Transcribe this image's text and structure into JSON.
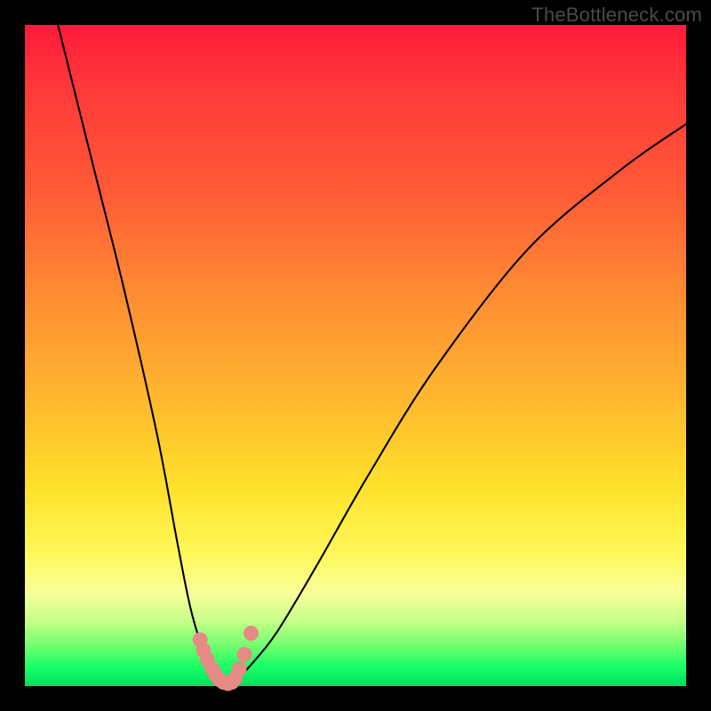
{
  "attribution": "TheBottleneck.com",
  "chart_data": {
    "type": "line",
    "title": "",
    "xlabel": "",
    "ylabel": "",
    "xlim": [
      0,
      100
    ],
    "ylim": [
      0,
      100
    ],
    "series": [
      {
        "name": "bottleneck-curve",
        "x": [
          5,
          10,
          15,
          20,
          23,
          25,
          27,
          28,
          29,
          30,
          31,
          32,
          34,
          38,
          44,
          52,
          62,
          76,
          90,
          100
        ],
        "values": [
          100,
          80,
          60,
          38,
          22,
          12,
          5,
          2,
          1,
          0,
          0,
          1,
          3,
          8,
          18,
          32,
          48,
          66,
          78,
          85
        ]
      }
    ],
    "markers": {
      "name": "highlight-points",
      "x": [
        26.5,
        27.0,
        27.6,
        28.3,
        28.8,
        29.4,
        30.0,
        30.7,
        31.3,
        31.8,
        32.4,
        33.2,
        34.2
      ],
      "values": [
        7.0,
        5.4,
        4.0,
        2.6,
        1.8,
        1.0,
        0.6,
        0.4,
        0.6,
        1.2,
        2.6,
        4.8,
        8.0
      ]
    },
    "gradient_stops": [
      {
        "pos": 0,
        "color": "#ff1a3a"
      },
      {
        "pos": 80,
        "color": "#fff85a"
      },
      {
        "pos": 97,
        "color": "#1aff66"
      },
      {
        "pos": 100,
        "color": "#00e060"
      }
    ]
  },
  "colors": {
    "curve": "#000000",
    "marker": "#e58a84",
    "background_frame": "#000000"
  }
}
